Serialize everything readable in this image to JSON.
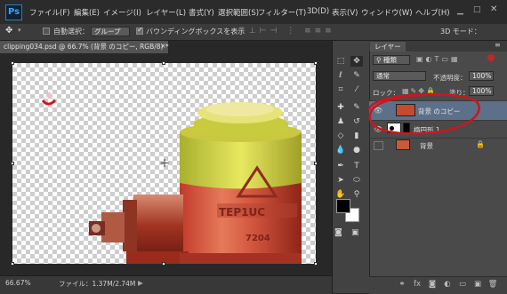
{
  "app": {
    "logo": "Ps"
  },
  "menu": [
    "ファイル(F)",
    "編集(E)",
    "イメージ(I)",
    "レイヤー(L)",
    "書式(Y)",
    "選択範囲(S)",
    "フィルター(T)",
    "3D(D)",
    "表示(V)",
    "ウィンドウ(W)",
    "ヘルプ(H)"
  ],
  "options": {
    "auto_select_label": "自動選択：",
    "auto_select_value": "グループ",
    "bbox_label": "バウンディングボックスを表示",
    "mode_3d": "3D モード："
  },
  "document": {
    "tab_title": "clipping034.psd @ 66.7% (背景 のコピー, RGB/8) *",
    "tab_close": "×"
  },
  "status": {
    "zoom": "66.67%",
    "file_info": "ファイル：1.37M/2.74M",
    "arrow": "▶"
  },
  "layers_panel": {
    "tab_label": "レイヤー",
    "filter_kind": "種類",
    "blend_mode": "通常",
    "opacity_label": "不透明度：",
    "opacity_value": "100%",
    "lock_label": "ロック：",
    "fill_label": "塗り：",
    "fill_value": "100%",
    "layers": [
      {
        "name": "背景 のコピー",
        "visible": true,
        "selected": true
      },
      {
        "name": "楕円形 1",
        "visible": true,
        "selected": false
      },
      {
        "name": "背景",
        "visible": false,
        "selected": false,
        "locked": true
      }
    ]
  },
  "annotation": {
    "circle_color": "#d0141e"
  },
  "colors": {
    "selected_layer": "#5d7089",
    "foreground": "#000000",
    "background": "#ffffff"
  }
}
